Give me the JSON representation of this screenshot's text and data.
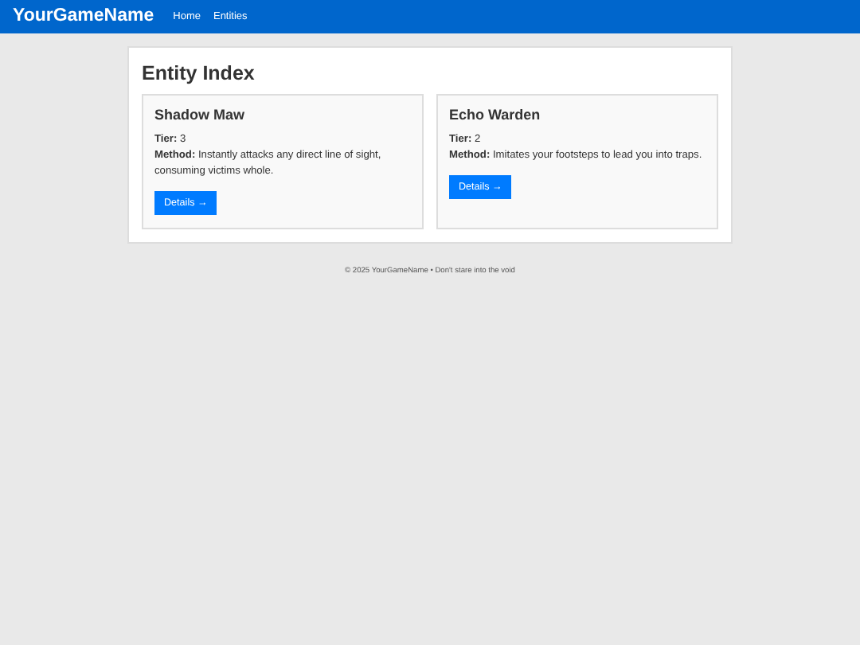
{
  "navbar": {
    "brand": "YourGameName",
    "links": [
      "Home",
      "Entities"
    ]
  },
  "page": {
    "title": "Entity Index",
    "entities": [
      {
        "name": "Shadow Maw",
        "tier": "**Tier:** 3",
        "method": "**Method:** Instantly attacks any direct line of sight, consuming victims whole.",
        "button": "Details →"
      },
      {
        "name": "Echo Warden",
        "tier": "**Tier:** 2",
        "method": "**Method:** Imitates your footsteps to lead you into traps.",
        "button": "Details →"
      }
    ]
  },
  "footer": "© 2025 YourGameName • Don't stare into the void"
}
